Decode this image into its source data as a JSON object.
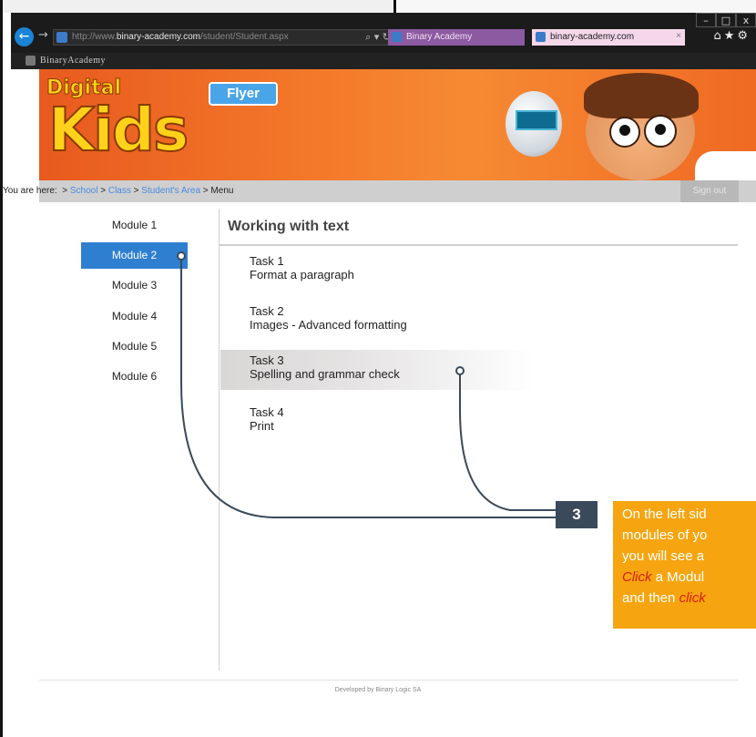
{
  "browser": {
    "url_prefix": "http://www.",
    "url_domain": "binary-academy.com",
    "url_path": "/student/Student.aspx",
    "tab1_label": "Binary Academy",
    "tab2_label": "binary-academy.com",
    "win_min": "–",
    "win_max": "□",
    "win_close": "x"
  },
  "site": {
    "brand": "BinaryAcademy",
    "banner_top": "Digital",
    "banner_main": "Kids",
    "banner_tag": "Flyer"
  },
  "breadcrumb": {
    "prefix": "You are here:",
    "items": [
      "School",
      "Class",
      "Student's Area"
    ],
    "current": "Menu",
    "sign_out": "Sign out"
  },
  "sidebar": {
    "items": [
      {
        "label": "Module 1"
      },
      {
        "label": "Module 2",
        "active": true
      },
      {
        "label": "Module 3"
      },
      {
        "label": "Module 4"
      },
      {
        "label": "Module 5"
      },
      {
        "label": "Module 6"
      }
    ]
  },
  "main": {
    "title": "Working with text",
    "tasks": [
      {
        "title": "Task 1",
        "subtitle": "Format a paragraph"
      },
      {
        "title": "Task 2",
        "subtitle": "Images - Advanced formatting"
      },
      {
        "title": "Task 3",
        "subtitle": "Spelling and grammar check",
        "highlighted": true
      },
      {
        "title": "Task 4",
        "subtitle": "Print"
      }
    ]
  },
  "footer": {
    "text": "Developed by Binary Logic SA"
  },
  "callout": {
    "number": "3",
    "line1": "On the left sid",
    "line2": "modules of yo",
    "line3": "you will see a",
    "line4_em": "Click",
    "line4_rest": " a Modul",
    "line5_pre": "and then ",
    "line5_em": "click"
  },
  "colors": {
    "active_module": "#2f7fd0",
    "callout_bg": "#f6a510",
    "callout_num_bg": "#3a4a5a",
    "banner_orange": "#f47a2a"
  }
}
